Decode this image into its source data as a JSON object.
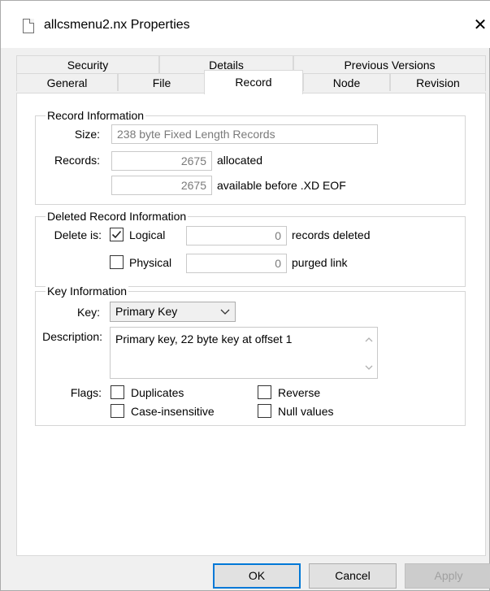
{
  "window": {
    "title": "allcsmenu2.nx Properties",
    "close_glyph": "✕"
  },
  "tabs_row1": [
    "Security",
    "Details",
    "Previous Versions"
  ],
  "tabs_row2": [
    "General",
    "File",
    "Record",
    "Node",
    "Revision"
  ],
  "active_tab": "Record",
  "record_info": {
    "legend": "Record Information",
    "size_label": "Size:",
    "size_value": "238 byte Fixed Length Records",
    "records_label": "Records:",
    "allocated_value": "2675",
    "allocated_label": "allocated",
    "available_value": "2675",
    "available_label": "available before .XD EOF"
  },
  "deleted_info": {
    "legend": "Deleted Record Information",
    "delete_is_label": "Delete is:",
    "logical_label": "Logical",
    "logical_checked": true,
    "deleted_value": "0",
    "deleted_label": "records deleted",
    "physical_label": "Physical",
    "physical_checked": false,
    "purged_value": "0",
    "purged_label": "purged link"
  },
  "key_info": {
    "legend": "Key Information",
    "key_label": "Key:",
    "key_selected": "Primary Key",
    "description_label": "Description:",
    "description_value": "Primary key, 22 byte key at offset 1",
    "flags_label": "Flags:",
    "duplicates_label": "Duplicates",
    "reverse_label": "Reverse",
    "case_insensitive_label": "Case-insensitive",
    "null_values_label": "Null values"
  },
  "buttons": {
    "ok": "OK",
    "cancel": "Cancel",
    "apply": "Apply"
  },
  "colors": {
    "accent": "#0078d7",
    "panel_bg": "#ffffff",
    "dialog_bg": "#f0f0f0"
  }
}
